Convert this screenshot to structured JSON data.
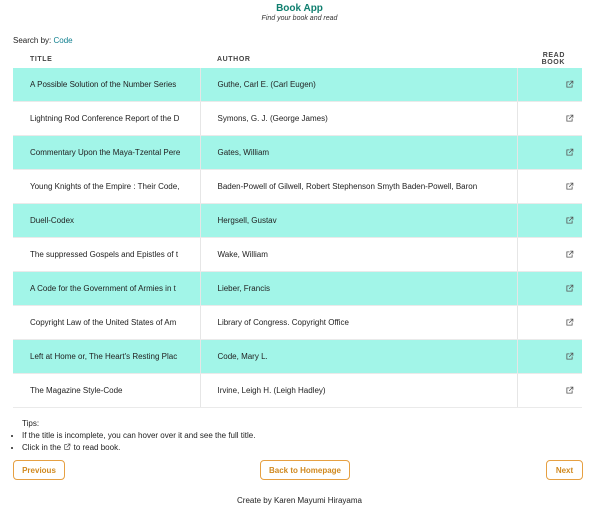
{
  "header": {
    "title": "Book App",
    "subtitle": "Find your book and read"
  },
  "search": {
    "label": "Search by:",
    "value": "Code"
  },
  "table": {
    "columns": [
      "TITLE",
      "AUTHOR",
      "READ BOOK"
    ],
    "rows": [
      {
        "title": "A Possible Solution of the Number Series",
        "author": "Guthe, Carl E. (Carl Eugen)"
      },
      {
        "title": "Lightning Rod Conference Report of the D",
        "author": "Symons, G. J. (George James)"
      },
      {
        "title": "Commentary Upon the Maya-Tzental Pere",
        "author": "Gates, William"
      },
      {
        "title": "Young Knights of the Empire : Their Code,",
        "author": "Baden-Powell of Gilwell, Robert Stephenson Smyth Baden-Powell, Baron"
      },
      {
        "title": "Duell-Codex",
        "author": "Hergsell, Gustav"
      },
      {
        "title": "The suppressed Gospels and Epistles of t",
        "author": "Wake, William"
      },
      {
        "title": "A Code for the Government of Armies in t",
        "author": "Lieber, Francis"
      },
      {
        "title": "Copyright Law of the United States of Am",
        "author": "Library of Congress. Copyright Office"
      },
      {
        "title": "Left at Home or, The Heart's Resting Plac",
        "author": "Code, Mary L."
      },
      {
        "title": "The Magazine Style-Code",
        "author": "Irvine, Leigh H. (Leigh Hadley)"
      }
    ],
    "read_icon": "external-link-icon"
  },
  "tips": {
    "title": "Tips:",
    "items": [
      "If the title is incomplete, you can hover over it and see the full title.",
      {
        "before": "Click in the",
        "icon": "external-link-icon",
        "after": "to read book."
      }
    ]
  },
  "buttons": {
    "previous": "Previous",
    "home": "Back to Homepage",
    "next": "Next"
  },
  "footer": {
    "text": "Create by Karen Mayumi Hirayama"
  },
  "colors": {
    "row_highlight": "#a2f5e8",
    "accent": "#0f7f6f",
    "button": "#e6a042"
  }
}
